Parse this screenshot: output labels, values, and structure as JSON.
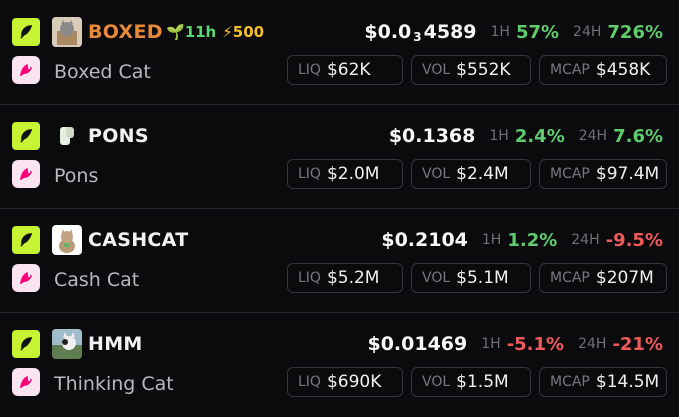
{
  "labels": {
    "h1": "1H",
    "h24": "24H",
    "liq": "LIQ",
    "vol": "VOL",
    "mcap": "MCAP"
  },
  "colors": {
    "chain_green": "#c6f432",
    "dex_pink": "#ff007a",
    "positive": "#5fcc6e",
    "negative": "#ef5b5b",
    "highlight_orange": "#e8893a"
  },
  "tokens": [
    {
      "symbol": "BOXED",
      "name": "Boxed Cat",
      "price_prefix": "$0.0",
      "price_sub": "3",
      "price_suffix": "4589",
      "badge_age": "11h",
      "badge_boost": "500",
      "change_1h": "57%",
      "change_24h": "726%",
      "liq": "$62K",
      "vol": "$552K",
      "mcap": "$458K"
    },
    {
      "symbol": "PONS",
      "name": "Pons",
      "price": "$0.1368",
      "change_1h": "2.4%",
      "change_24h": "7.6%",
      "liq": "$2.0M",
      "vol": "$2.4M",
      "mcap": "$97.4M"
    },
    {
      "symbol": "CASHCAT",
      "name": "Cash Cat",
      "price": "$0.2104",
      "change_1h": "1.2%",
      "change_24h": "-9.5%",
      "liq": "$5.2M",
      "vol": "$5.1M",
      "mcap": "$207M"
    },
    {
      "symbol": "HMM",
      "name": "Thinking Cat",
      "price": "$0.01469",
      "change_1h": "-5.1%",
      "change_24h": "-21%",
      "liq": "$690K",
      "vol": "$1.5M",
      "mcap": "$14.5M"
    }
  ]
}
